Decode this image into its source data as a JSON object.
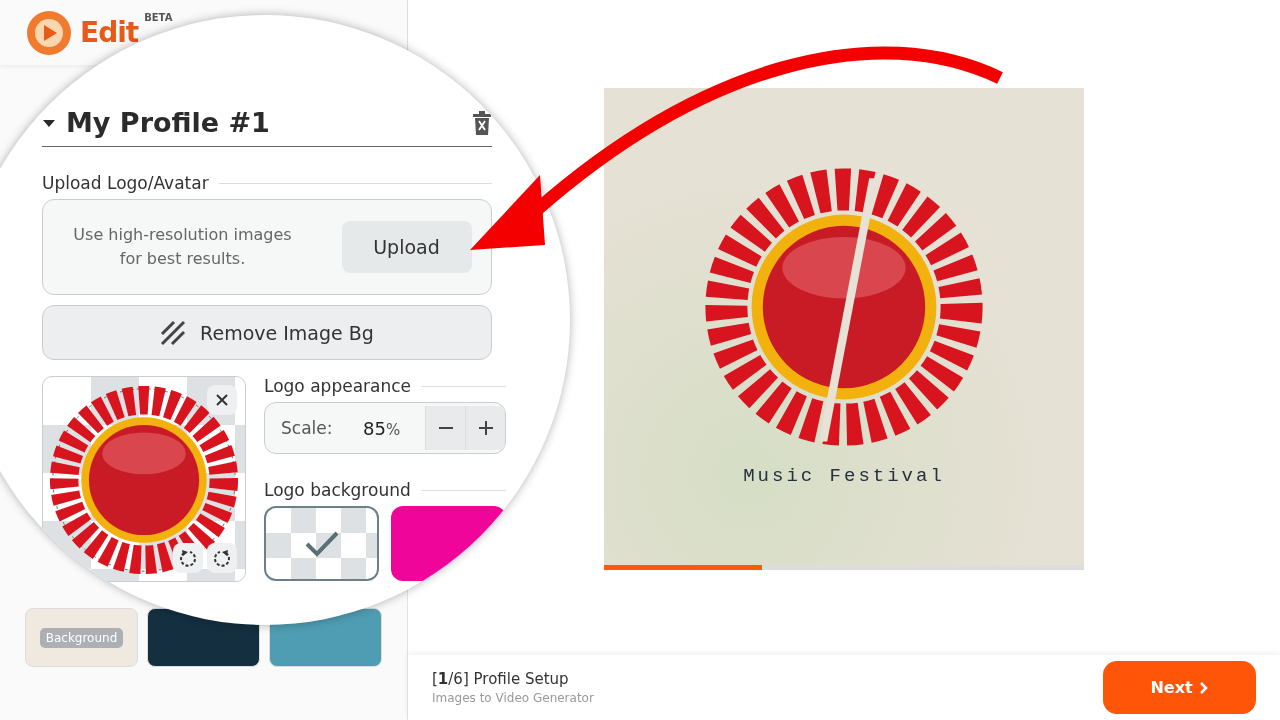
{
  "app": {
    "logo_text": "Edit",
    "beta": "BETA"
  },
  "profile": {
    "title": "My Profile #1",
    "expanded": true,
    "upload_label": "Upload Logo/Avatar",
    "upload_hint": "Use high-resolution images for best results.",
    "upload_button": "Upload",
    "remove_bg_button": "Remove Image Bg",
    "appearance_label": "Logo appearance",
    "scale_label": "Scale:",
    "scale_value": "85",
    "scale_unit": "%",
    "background_label": "Logo background",
    "backgrounds": [
      {
        "kind": "transparent",
        "selected": true
      },
      {
        "kind": "solid",
        "color": "#f0059a",
        "selected": false
      }
    ]
  },
  "tiles": [
    {
      "label": "Background",
      "color": "#efe9df"
    },
    {
      "color": "#142f40"
    },
    {
      "color": "#4f9db3"
    }
  ],
  "preview": {
    "caption": "Music Festival",
    "level": 0.33
  },
  "footer": {
    "step": "[**1**/6] Profile Setup",
    "subtitle": "Images to Video Generator",
    "next_button": "Next"
  }
}
